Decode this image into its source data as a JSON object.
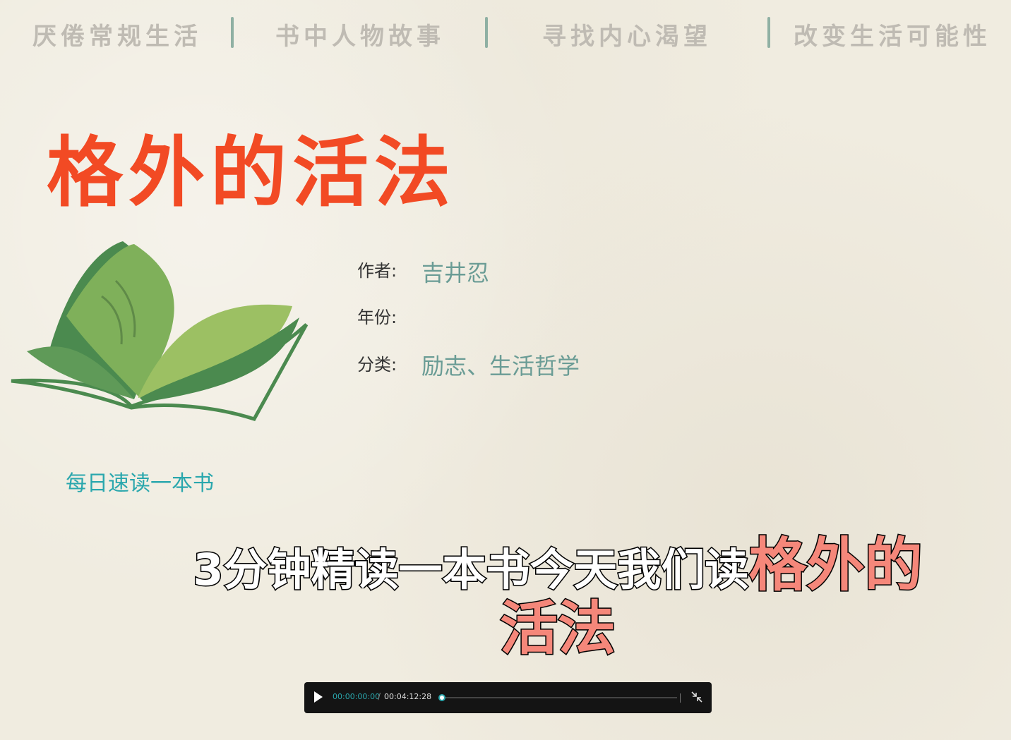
{
  "topnav": {
    "items": [
      "厌倦常规生活",
      "书中人物故事",
      "寻找内心渴望",
      "改变生活可能性"
    ]
  },
  "title": "格外的活法",
  "meta": {
    "author_label": "作者:",
    "author_value": "吉井忍",
    "year_label": "年份:",
    "year_value": "",
    "category_label": "分类:",
    "category_value": "励志、生活哲学"
  },
  "slogan": "每日速读一本书",
  "subtitle": {
    "prefix": "3分钟精读一本书今天我们读",
    "highlight": "格外的活法"
  },
  "player": {
    "current_time": "00:00:00:00",
    "separator": "/",
    "duration": "00:04:12:28",
    "progress": 0
  },
  "colors": {
    "title": "#f24a24",
    "meta_value": "#6a9c95",
    "slogan": "#2aa7ad",
    "subtitle_highlight": "#f5877a"
  }
}
